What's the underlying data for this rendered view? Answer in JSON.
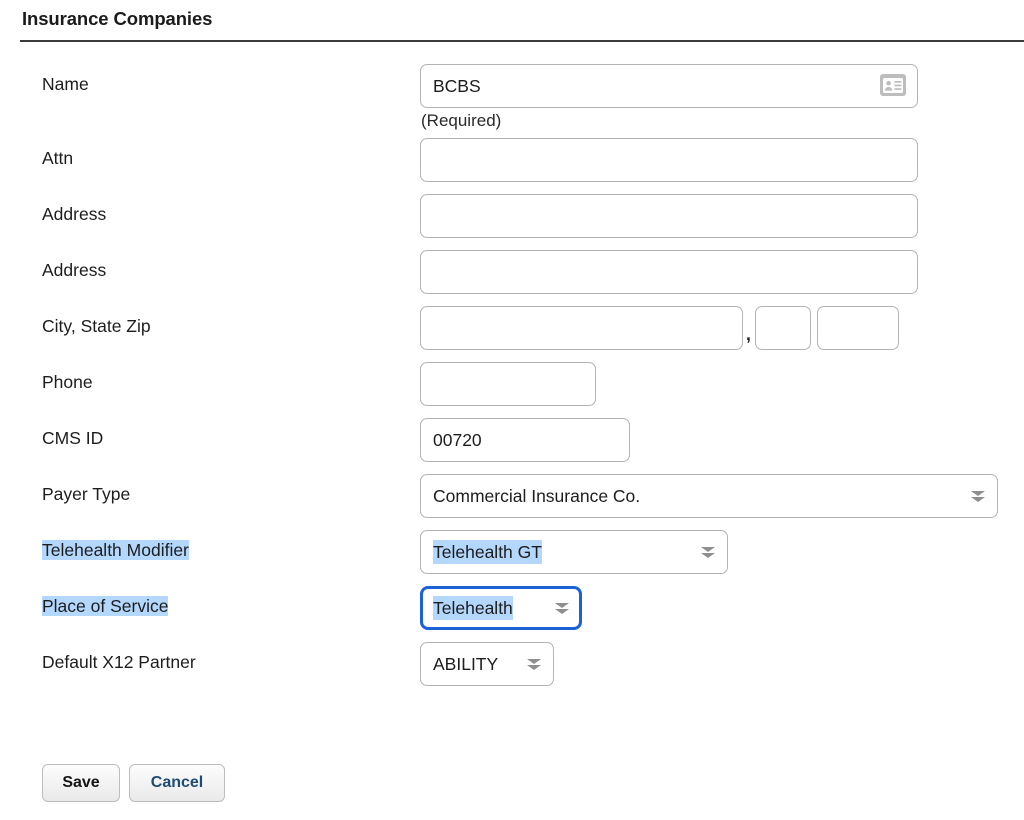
{
  "page": {
    "title": "Insurance Companies"
  },
  "form": {
    "name": {
      "label": "Name",
      "value": "BCBS",
      "placeholder": "",
      "icon": "contact-card-icon",
      "note": "(Required)"
    },
    "attn": {
      "label": "Attn",
      "value": "",
      "placeholder": ""
    },
    "address1": {
      "label": "Address",
      "value": "",
      "placeholder": ""
    },
    "address2": {
      "label": "Address",
      "value": "",
      "placeholder": ""
    },
    "city_state_zip": {
      "label": "City, State Zip",
      "city_value": "",
      "separator": ",",
      "state_value": "",
      "zip_value": ""
    },
    "phone": {
      "label": "Phone",
      "value": "",
      "placeholder": ""
    },
    "cms_id": {
      "label": "CMS ID",
      "value": "00720",
      "placeholder": ""
    },
    "payer_type": {
      "label": "Payer Type",
      "value": "Commercial Insurance Co.",
      "icon": "chevron-double-down-icon"
    },
    "telehealth_modifier": {
      "label": "Telehealth Modifier",
      "value": "Telehealth GT",
      "icon": "chevron-double-down-icon"
    },
    "place_of_service": {
      "label": "Place of Service",
      "value": "Telehealth",
      "icon": "chevron-double-down-icon"
    },
    "default_x12_partner": {
      "label": "Default X12 Partner",
      "value": "ABILITY",
      "icon": "chevron-double-down-icon"
    }
  },
  "actions": {
    "save_label": "Save",
    "cancel_label": "Cancel"
  },
  "colors": {
    "selection_highlight": "#b3d7fd",
    "focus_ring": "#1a62d6",
    "input_border": "#b4b4b4",
    "cancel_text": "#1d4b73",
    "rule": "#3b3b3b"
  }
}
